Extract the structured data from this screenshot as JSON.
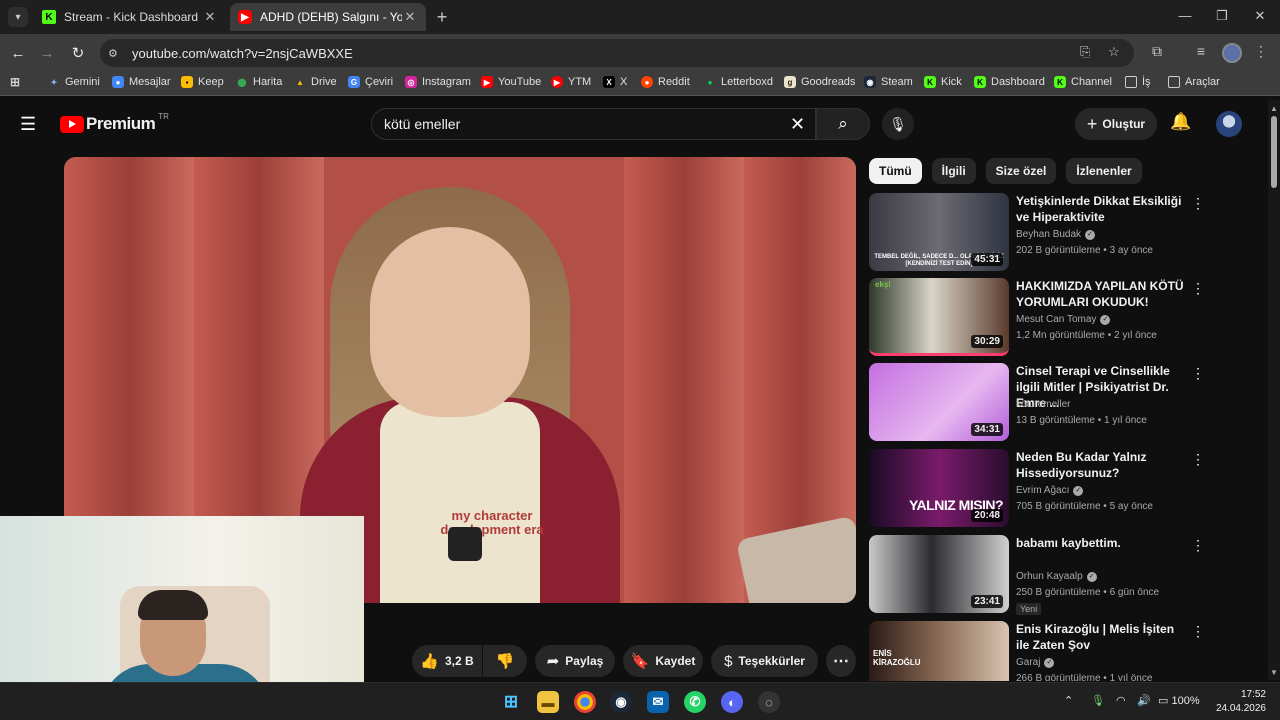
{
  "browser": {
    "tabs": [
      {
        "title": "Stream - Kick Dashboard",
        "icon": "kick-icon"
      },
      {
        "title": "ADHD (DEHB) Salgını - YouTube",
        "icon": "youtube-icon"
      }
    ],
    "url": "youtube.com/watch?v=2nsjCaWBXXE",
    "bookmarks": [
      "Gemini",
      "Mesajlar",
      "Keep",
      "Harita",
      "Drive",
      "Çeviri",
      "Instagram",
      "YouTube",
      "YTM",
      "X",
      "Reddit",
      "Letterboxd",
      "Goodreads",
      "Steam",
      "Kick",
      "Dashboard",
      "Channel",
      "İş",
      "Araçlar"
    ]
  },
  "yt": {
    "logo_text": "Premium",
    "region": "TR",
    "search_value": "kötü emeller",
    "create_label": "Oluştur"
  },
  "video": {
    "shirt_text": "my character development era",
    "likes": "3,2 B",
    "share_label": "Paylaş",
    "save_label": "Kaydet",
    "thanks_label": "Teşekkürler"
  },
  "chips": [
    "Tümü",
    "İlgili",
    "Size özel",
    "İzlenenler"
  ],
  "recommendations": [
    {
      "title": "Yetişkinlerde Dikkat Eksikliği ve Hiperaktivite",
      "channel": "Beyhan Budak",
      "verified": true,
      "views": "202 B görüntüleme",
      "age": "3 ay önce",
      "duration": "45:31",
      "thumb_text": "TEMBEL DEĞİL, SADECE D... OLABİLİRSİNİZ [KENDİNİZİ TEST EDİN]"
    },
    {
      "title": "HAKKIMIZDA YAPILAN KÖTÜ YORUMLARI OKUDUK!",
      "channel": "Mesut Can Tomay",
      "verified": true,
      "views": "1,2 Mn görüntüleme",
      "age": "2 yıl önce",
      "duration": "30:29",
      "thumb_text": "ekşi"
    },
    {
      "title": "Cinsel Terapi ve Cinsellikle ilgili Mitler | Psikiyatrist Dr. Emre ...",
      "channel": "kötü emeller",
      "verified": false,
      "views": "13 B görüntüleme",
      "age": "1 yıl önce",
      "duration": "34:31",
      "thumb_text": ""
    },
    {
      "title": "Neden Bu Kadar Yalnız Hissediyorsunuz?",
      "channel": "Evrim Ağacı",
      "verified": true,
      "views": "705 B görüntüleme",
      "age": "5 ay önce",
      "duration": "20:48",
      "thumb_text": "YALNIZ MISIN?"
    },
    {
      "title": "babamı kaybettim.",
      "channel": "Orhun Kayaalp",
      "verified": true,
      "views": "250 B görüntüleme",
      "age": "6 gün önce",
      "duration": "23:41",
      "thumb_text": "",
      "badge": "Yeni"
    },
    {
      "title": "Enis Kirazoğlu | Melis İşiten ile Zaten Şov",
      "channel": "Garaj",
      "verified": true,
      "views": "266 B görüntüleme",
      "age": "1 yıl önce",
      "duration": "",
      "thumb_text": "ENİS KİRAZOĞLU"
    }
  ],
  "taskbar": {
    "battery": "100%",
    "time": "17:52",
    "date": "24.04.2026"
  },
  "colors": {
    "accent": "#ff0000",
    "bg": "#0f0f0f",
    "chip_active": "#f1f1f1"
  }
}
